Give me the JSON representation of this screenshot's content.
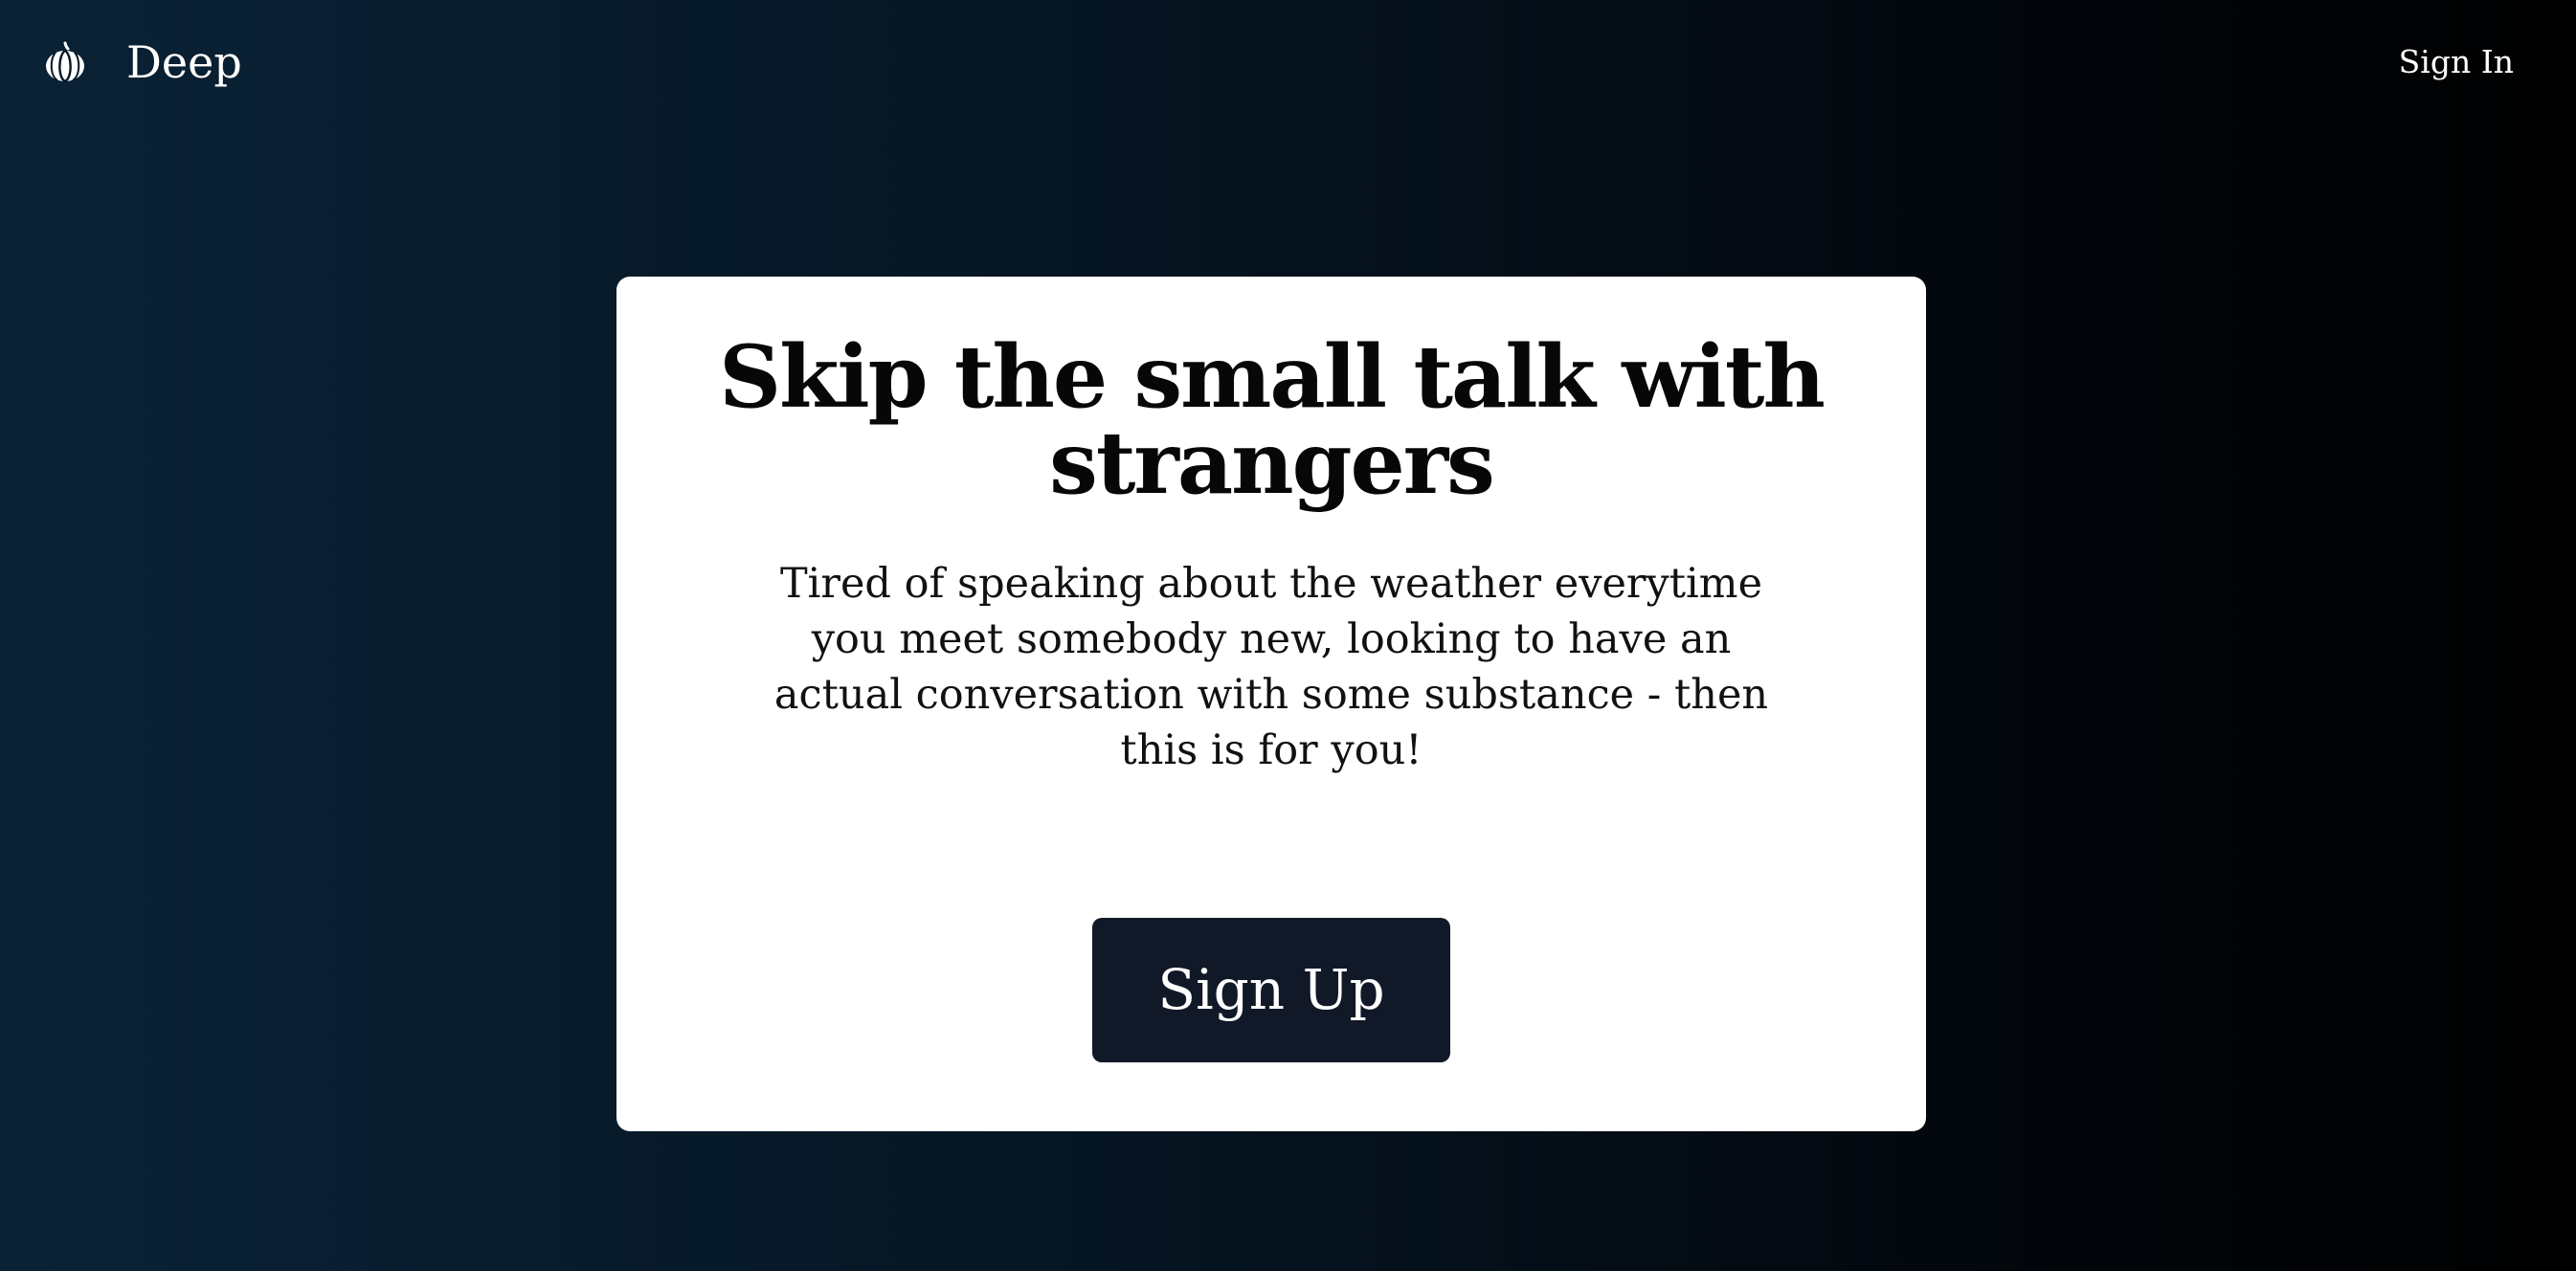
{
  "navbar": {
    "brand_name": "Deep",
    "brand_icon": "pumpkin-icon",
    "signin_label": "Sign In"
  },
  "hero": {
    "headline": "Skip the small talk with strangers",
    "subtext": "Tired of speaking about the weather everytime you meet somebody new, looking to have an actual conversation with some substance - then this is for you!",
    "signup_label": "Sign Up"
  },
  "colors": {
    "background_start": "#0a2236",
    "background_end": "#000000",
    "card": "#ffffff",
    "button": "#111827",
    "text_dark": "#070707",
    "text_light": "#ffffff"
  }
}
